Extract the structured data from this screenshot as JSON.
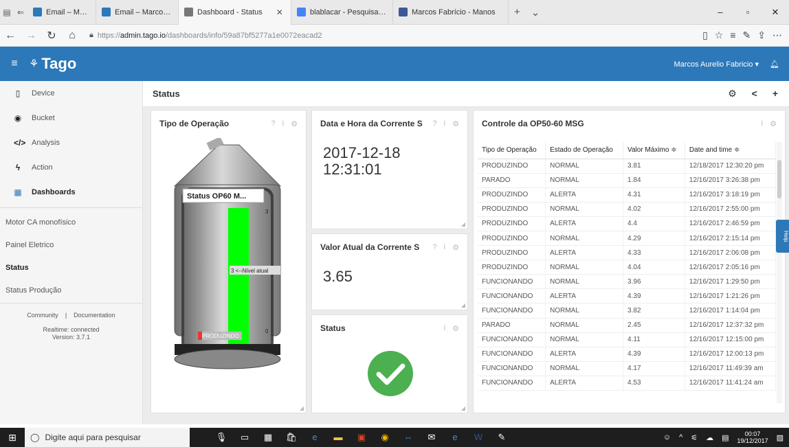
{
  "browser": {
    "tabs": [
      {
        "label": "Email – Marcos Aurelio Fabr",
        "favicon_color": "#2c78b9",
        "active": false
      },
      {
        "label": "Email – Marcos Aurelio Fabr",
        "favicon_color": "#2c78b9",
        "active": false
      },
      {
        "label": "Dashboard - Status",
        "favicon_color": "#777777",
        "active": true
      },
      {
        "label": "blablacar - Pesquisa Google",
        "favicon_color": "#4285f4",
        "active": false
      },
      {
        "label": "Marcos Fabrício - Manos",
        "favicon_color": "#3b5998",
        "active": false
      }
    ],
    "url_prefix": "https://",
    "url_host": "admin.tago.io",
    "url_path": "/dashboards/info/59a87bf5277a1e0072eacad2"
  },
  "app": {
    "logo": "Tago",
    "user": "Marcos Aurelio Fabricio ▾"
  },
  "sidebar": {
    "items": [
      {
        "label": "Device",
        "icon": "device-icon",
        "glyph": "▯"
      },
      {
        "label": "Bucket",
        "icon": "bucket-icon",
        "glyph": "◉"
      },
      {
        "label": "Analysis",
        "icon": "code-icon",
        "glyph": "</>"
      },
      {
        "label": "Action",
        "icon": "action-icon",
        "glyph": "ϟ"
      },
      {
        "label": "Dashboards",
        "icon": "dashboards-icon",
        "glyph": "▦"
      }
    ],
    "dashboards": [
      "Motor CA monofísico",
      "Painel Eletrico",
      "Status",
      "Status Produção"
    ],
    "footer_links": [
      "Community",
      "|",
      "Documentation"
    ],
    "realtime": "Realtime: connected",
    "version": "Version: 3.7.1"
  },
  "main": {
    "title": "Status"
  },
  "widgets": {
    "tipo": {
      "title": "Tipo de Operação",
      "tank_label": "Status OP60 M...",
      "level_text": "3 <--Nível atual",
      "scale_top": "3",
      "scale_bottom": "0",
      "state_label": "PRODUZINDO",
      "level_fraction": 1.0
    },
    "datahora": {
      "title": "Data e Hora da Corrente S",
      "date": "2017-12-18",
      "time": "12:31:01"
    },
    "valor": {
      "title": "Valor Atual da Corrente S",
      "value": "3.65"
    },
    "status": {
      "title": "Status"
    },
    "controle": {
      "title": "Controle da OP50-60 MSG",
      "columns": [
        "Tipo de Operação",
        "Estado de Operação",
        "Valor Máximo ≑",
        "Date and time ≑"
      ],
      "rows": [
        [
          "PRODUZINDO",
          "NORMAL",
          "3.81",
          "12/18/2017 12:30:20 pm"
        ],
        [
          "PARADO",
          "NORMAL",
          "1.84",
          "12/16/2017 3:26:38 pm"
        ],
        [
          "PRODUZINDO",
          "ALERTA",
          "4.31",
          "12/16/2017 3:18:19 pm"
        ],
        [
          "PRODUZINDO",
          "NORMAL",
          "4.02",
          "12/16/2017 2:55:00 pm"
        ],
        [
          "PRODUZINDO",
          "ALERTA",
          "4.4",
          "12/16/2017 2:46:59 pm"
        ],
        [
          "PRODUZINDO",
          "NORMAL",
          "4.29",
          "12/16/2017 2:15:14 pm"
        ],
        [
          "PRODUZINDO",
          "ALERTA",
          "4.33",
          "12/16/2017 2:06:08 pm"
        ],
        [
          "PRODUZINDO",
          "NORMAL",
          "4.04",
          "12/16/2017 2:05:16 pm"
        ],
        [
          "FUNCIONANDO",
          "NORMAL",
          "3.96",
          "12/16/2017 1:29:50 pm"
        ],
        [
          "FUNCIONANDO",
          "ALERTA",
          "4.39",
          "12/16/2017 1:21:26 pm"
        ],
        [
          "FUNCIONANDO",
          "NORMAL",
          "3.82",
          "12/16/2017 1:14:04 pm"
        ],
        [
          "PARADO",
          "NORMAL",
          "2.45",
          "12/16/2017 12:37:32 pm"
        ],
        [
          "FUNCIONANDO",
          "NORMAL",
          "4.11",
          "12/16/2017 12:15:00 pm"
        ],
        [
          "FUNCIONANDO",
          "ALERTA",
          "4.39",
          "12/16/2017 12:00:13 pm"
        ],
        [
          "FUNCIONANDO",
          "NORMAL",
          "4.17",
          "12/16/2017 11:49:39 am"
        ],
        [
          "FUNCIONANDO",
          "ALERTA",
          "4.53",
          "12/16/2017 11:41:24 am"
        ]
      ]
    }
  },
  "help_tab": "Help",
  "taskbar": {
    "search": "Digite aqui para pesquisar",
    "time": "00:07",
    "date": "19/12/2017"
  },
  "colors": {
    "header": "#2c78b9",
    "level": "#00ff00",
    "ok": "#4caf50"
  }
}
